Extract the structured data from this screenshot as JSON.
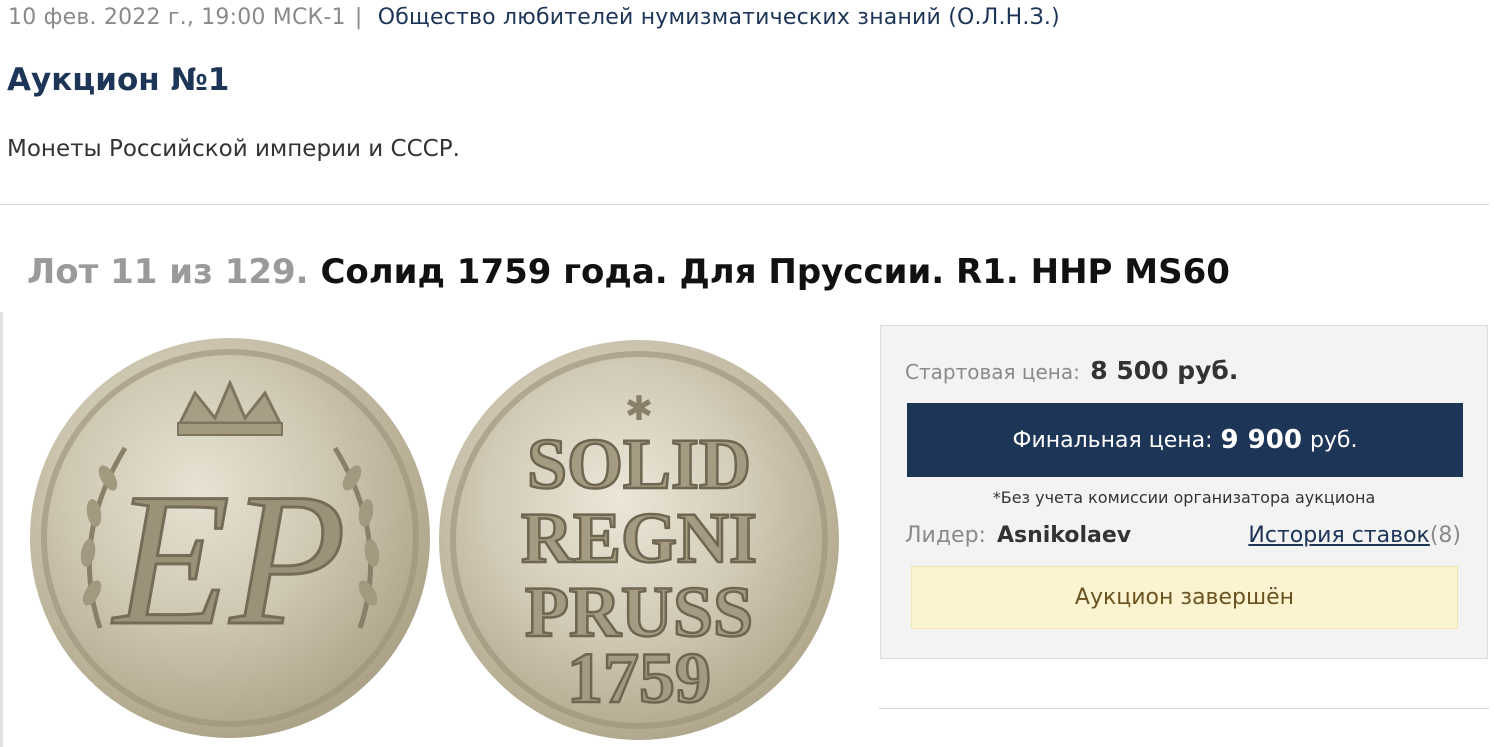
{
  "header": {
    "date": "10 фев. 2022 г., 19:00 МСК-1",
    "separator": "|",
    "organizer": "Общество любителей нумизматических знаний (О.Л.Н.З.)"
  },
  "auction": {
    "title": "Аукцион №1",
    "description": "Монеты Российской империи и СССР."
  },
  "lot": {
    "prefix": "Лот 11 из 129.",
    "name": "Солид 1759 года. Для Пруссии. R1. ННР MS60"
  },
  "images": {
    "obverse_monogram": "ЕР",
    "reverse_lines": [
      "SOLID",
      "REGNI",
      "PRUSS",
      "1759"
    ]
  },
  "price_panel": {
    "start_label": "Стартовая цена:",
    "start_value": "8 500 руб.",
    "final_label": "Финальная цена:",
    "final_amount": "9 900",
    "final_currency": "руб.",
    "commission_note": "*Без учета комиссии организатора аукциона",
    "leader_label": "Лидер:",
    "leader_name": "Asnikolaev",
    "history_link": "История ставок",
    "history_count": "(8)",
    "status": "Аукцион завершён"
  },
  "colors": {
    "brand_dark": "#1d3557",
    "status_bg": "#fcf3d1",
    "panel_bg": "#f3f3f3"
  }
}
